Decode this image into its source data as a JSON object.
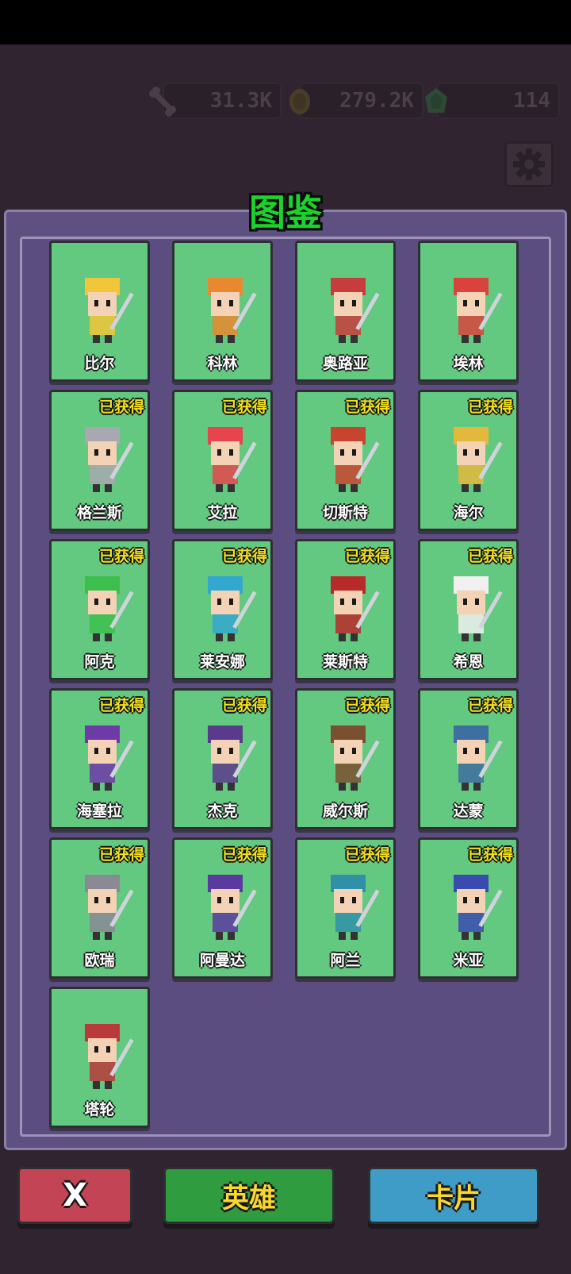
{
  "title": "图鉴",
  "resources": {
    "bone": "31.3K",
    "coin": "279.2K",
    "gem": "114"
  },
  "badge_text": "已获得",
  "heroes": [
    {
      "name": "比尔",
      "owned": false,
      "color": "#f2c63a"
    },
    {
      "name": "科林",
      "owned": false,
      "color": "#e8892f"
    },
    {
      "name": "奥路亚",
      "owned": false,
      "color": "#c73d3d"
    },
    {
      "name": "埃林",
      "owned": false,
      "color": "#d8433c"
    },
    {
      "name": "格兰斯",
      "owned": true,
      "color": "#a8a8b0"
    },
    {
      "name": "艾拉",
      "owned": true,
      "color": "#e6454e"
    },
    {
      "name": "切斯特",
      "owned": true,
      "color": "#c8442f"
    },
    {
      "name": "海尔",
      "owned": true,
      "color": "#e3b83c"
    },
    {
      "name": "阿克",
      "owned": true,
      "color": "#3cbf4c"
    },
    {
      "name": "莱安娜",
      "owned": true,
      "color": "#32a8d0"
    },
    {
      "name": "莱斯特",
      "owned": true,
      "color": "#b82a2a"
    },
    {
      "name": "希恩",
      "owned": true,
      "color": "#f0f0f0"
    },
    {
      "name": "海塞拉",
      "owned": true,
      "color": "#6d3aa8"
    },
    {
      "name": "杰克",
      "owned": true,
      "color": "#5a3a8c"
    },
    {
      "name": "威尔斯",
      "owned": true,
      "color": "#7a5030"
    },
    {
      "name": "达蒙",
      "owned": true,
      "color": "#3d6fa0"
    },
    {
      "name": "欧瑞",
      "owned": true,
      "color": "#8a8a94"
    },
    {
      "name": "阿曼达",
      "owned": true,
      "color": "#5b3aa0"
    },
    {
      "name": "阿兰",
      "owned": true,
      "color": "#2f90a8"
    },
    {
      "name": "米亚",
      "owned": true,
      "color": "#3a4bb0"
    },
    {
      "name": "塔轮",
      "owned": false,
      "color": "#b83a3a"
    }
  ],
  "buttons": {
    "close": "X",
    "hero": "英雄",
    "card": "卡片"
  }
}
